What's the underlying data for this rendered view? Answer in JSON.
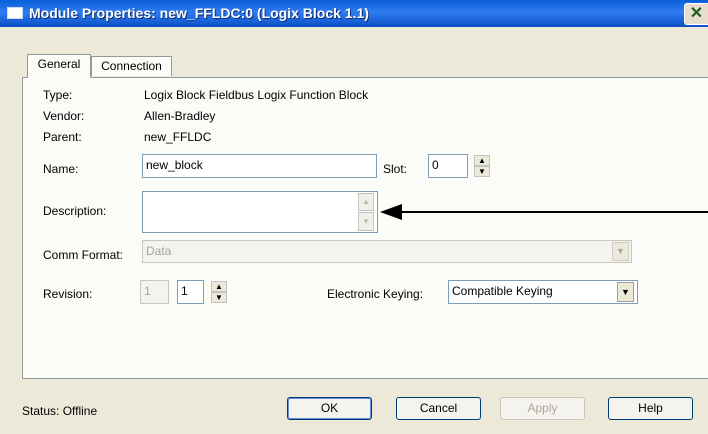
{
  "window": {
    "title": "Module Properties: new_FFLDC:0 (Logix Block 1.1)",
    "close_icon": "close-x"
  },
  "tabs": [
    {
      "label": "General",
      "active": true
    },
    {
      "label": "Connection",
      "active": false
    }
  ],
  "general": {
    "type_label": "Type:",
    "type_value": "Logix Block Fieldbus Logix Function Block",
    "vendor_label": "Vendor:",
    "vendor_value": "Allen-Bradley",
    "parent_label": "Parent:",
    "parent_value": "new_FFLDC",
    "name_label": "Name:",
    "name_value": "new_block",
    "slot_label": "Slot:",
    "slot_value": "0",
    "description_label": "Description:",
    "description_value": "",
    "comm_format_label": "Comm Format:",
    "comm_format_value": "Data",
    "revision_label": "Revision:",
    "revision_major": "1",
    "revision_minor": "1",
    "keying_label": "Electronic Keying:",
    "keying_value": "Compatible Keying"
  },
  "status": {
    "text": "Status:  Offline"
  },
  "buttons": {
    "ok": "OK",
    "cancel": "Cancel",
    "apply": "Apply",
    "help": "Help"
  }
}
